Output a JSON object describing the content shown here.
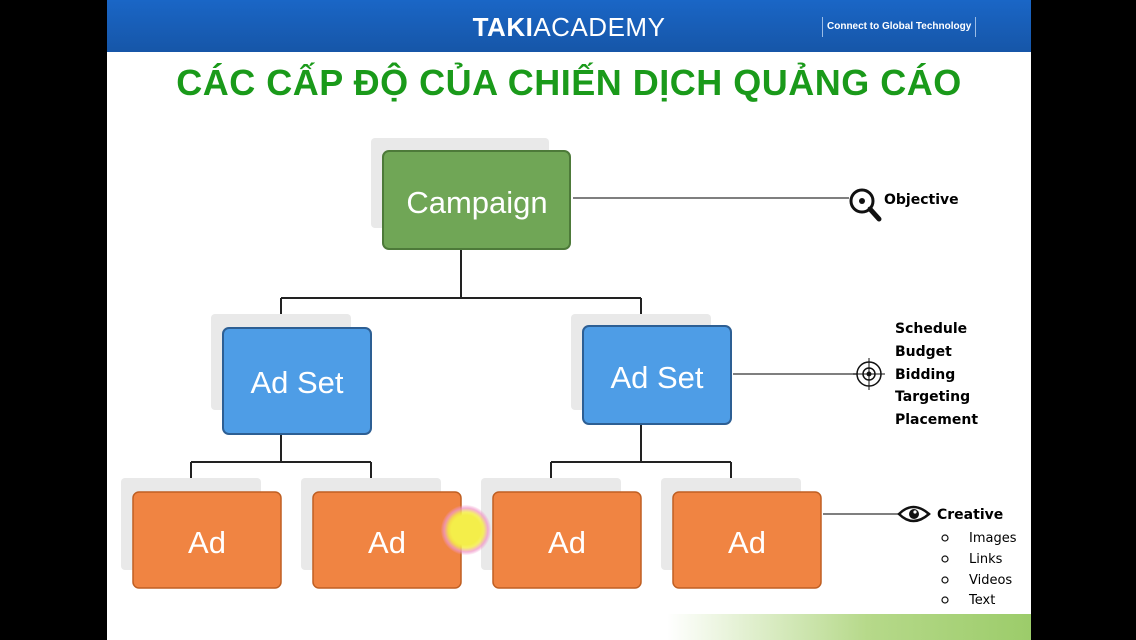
{
  "header": {
    "logo_bold": "TAKI",
    "logo_thin": "ACADEMY",
    "tagline": "Connect to Global Technology"
  },
  "title": "CÁC CẤP ĐỘ CỦA CHIẾN DỊCH QUẢNG CÁO",
  "diagram": {
    "campaign": {
      "label": "Campaign",
      "color": "#70a656"
    },
    "ad_sets": [
      {
        "label": "Ad Set",
        "color": "#4e9de6"
      },
      {
        "label": "Ad Set",
        "color": "#4e9de6"
      }
    ],
    "ads": [
      {
        "label": "Ad",
        "color": "#f08442"
      },
      {
        "label": "Ad",
        "color": "#f08442"
      },
      {
        "label": "Ad",
        "color": "#f08442"
      },
      {
        "label": "Ad",
        "color": "#f08442"
      }
    ]
  },
  "annotations": {
    "campaign": {
      "icon": "magnifier-icon",
      "label": "Objective"
    },
    "ad_set": {
      "icon": "target-icon",
      "items": [
        "Schedule",
        "Budget",
        "Bidding",
        "Targeting",
        "Placement"
      ]
    },
    "ad": {
      "icon": "eye-icon",
      "label": "Creative",
      "bullets": [
        "Images",
        "Links",
        "Videos",
        "Text"
      ]
    }
  }
}
